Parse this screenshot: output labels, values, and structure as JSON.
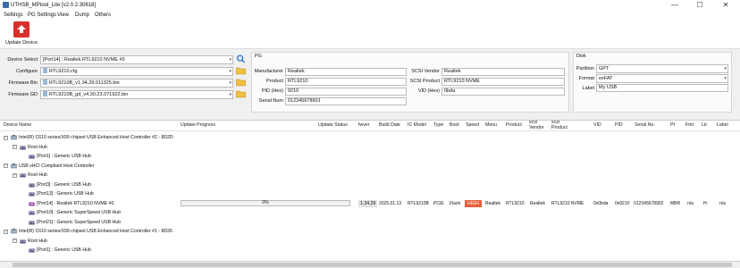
{
  "window": {
    "title": "UTHSB_MPtool_Lite [v2.0.2.30818]",
    "min": "—",
    "max": "☐",
    "close": "✕"
  },
  "menu": [
    "Settings",
    "PG Settings",
    "View",
    "Dump",
    "Others"
  ],
  "toolbar": {
    "update_label": "Update Device"
  },
  "left_panel": {
    "device_select_label": "Device Select",
    "device_select_value": "[Port14] : Realtek RTL9210 NVME #0",
    "configure_label": "Configure",
    "configure_value": "RTL9210.cfg",
    "fw_bin_label": "Firmware Bin",
    "fw_bin_value": "RTL9210B_v1.34.29.011325.bin",
    "fw_gd_label": "Firmware GD",
    "fw_gd_value": "RTL9210B_gd_v4.30.23.071922.bin"
  },
  "pg": {
    "title": "PG",
    "manufacturer_label": "Manufacturer",
    "manufacturer": "Realtek",
    "product_label": "Product",
    "product": "RTL9210",
    "pid_label": "PID (Hex)",
    "pid": "9210",
    "serial_label": "Serial Num",
    "serial": "012345678901",
    "scsi_vendor_label": "SCSI Vendor",
    "scsi_vendor": "Realtek",
    "scsi_product_label": "SCSI Product",
    "scsi_product": "RTL9210 NVME",
    "vid_label": "VID (Hex)",
    "vid": "0bda"
  },
  "disk": {
    "title": "Disk",
    "partition_label": "Partition",
    "partition": "GPT",
    "format_label": "Format",
    "format": "exFAT",
    "label_label": "Label",
    "label": "My USB"
  },
  "table": {
    "headers": {
      "device_name": "Device Name",
      "update_progress": "Update Progress",
      "update_status": "Update Status",
      "fwver": "fwver",
      "build_date": "Build Date",
      "ic_model": "IC Model",
      "type": "Type",
      "boot": "Boot",
      "speed": "Speed",
      "menu": "Menu",
      "product": "Product",
      "scsi_vendor": "scsi Vendor",
      "scsi_product": "scsi Product",
      "vid": "VID",
      "pid": "PID",
      "serial_no": "Serial No.",
      "pt": "Pt",
      "fmt": "Fmt",
      "ltr": "Ltr",
      "label": "Label"
    },
    "rows": [
      {
        "level": 0,
        "toggle": "−",
        "icon": "usb-controller",
        "name": "Intel(R) C610 series/X99 chipset USB Enhanced Host Controller #2 - 8D2D"
      },
      {
        "level": 1,
        "toggle": "−",
        "icon": "usb-hub",
        "name": "Root Hub"
      },
      {
        "level": 2,
        "toggle": "",
        "icon": "usb-hub",
        "name": "[Port1] : Generic USB Hub"
      },
      {
        "level": 0,
        "toggle": "−",
        "icon": "usb-controller",
        "name": "USB xHCI Compliant Host Controller"
      },
      {
        "level": 1,
        "toggle": "−",
        "icon": "usb-hub",
        "name": "Root Hub"
      },
      {
        "level": 2,
        "toggle": "",
        "icon": "usb-hub",
        "name": "[Port3] : Generic USB Hub"
      },
      {
        "level": 2,
        "toggle": "",
        "icon": "usb-hub",
        "name": "[Port13] : Generic USB Hub"
      },
      {
        "level": 2,
        "toggle": "",
        "icon": "usb-storage",
        "name": "[Port14] : Realtek RTL9210 NVME #0",
        "device": {
          "progress": "0%",
          "progress_value": 0,
          "fwver": "1.34.29",
          "build_date": "2025.01.13",
          "ic_model": "RTL9210B",
          "type": "PCIE",
          "boot": "Flash",
          "speed": "HIGH",
          "menu": "Realtek",
          "product": "RTL9210",
          "scsi_vendor": "Realtek",
          "scsi_product": "RTL9210 NVME",
          "vid": "0x0bda",
          "pid": "0x9210",
          "serial_no": "012345678902",
          "pt": "MBR",
          "fmt": "n/a",
          "ltr": "H:",
          "label": "n/a"
        }
      },
      {
        "level": 2,
        "toggle": "",
        "icon": "usb-hub",
        "name": "[Port19] : Generic SuperSpeed USB Hub"
      },
      {
        "level": 2,
        "toggle": "",
        "icon": "usb-hub",
        "name": "[Port21] : Generic SuperSpeed USB Hub"
      },
      {
        "level": 0,
        "toggle": "−",
        "icon": "usb-controller",
        "name": "Intel(R) C610 series/X99 chipset USB Enhanced Host Controller #1 - 8D26"
      },
      {
        "level": 1,
        "toggle": "−",
        "icon": "usb-hub",
        "name": "Root Hub"
      },
      {
        "level": 2,
        "toggle": "",
        "icon": "usb-hub",
        "name": "[Port1] : Generic USB Hub"
      }
    ]
  },
  "colors": {
    "update_button": "#d9302c",
    "speed_badge": "#e8603c",
    "folder": "#f0c040",
    "search": "#1f6fc4"
  }
}
